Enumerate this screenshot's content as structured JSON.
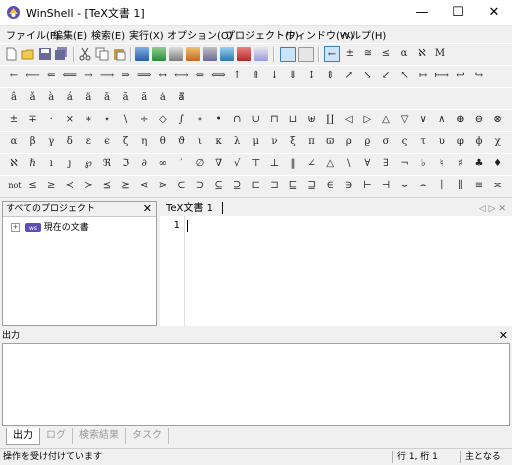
{
  "window": {
    "title": "WinShell - [TeX文書 1]",
    "minimize": "—",
    "maximize": "☐",
    "close": "✕"
  },
  "menu": [
    "ファイル(F)",
    "編集(E)",
    "検索(E)",
    "実行(X)",
    "オプション(O)",
    "プロジェクト(P)",
    "ウィンドウ(W)",
    "ヘルプ(H)"
  ],
  "toolbar1": {
    "math_buttons": [
      "←",
      "±",
      "≅",
      "≤",
      "α",
      "ℵ",
      "M"
    ]
  },
  "symbol_rows": [
    [
      "←",
      "⟵",
      "⇐",
      "⟸",
      "→",
      "⟶",
      "⇒",
      "⟹",
      "↔",
      "⟷",
      "⇔",
      "⟺",
      "↑",
      "⇑",
      "↓",
      "⇓",
      "↕",
      "⇕",
      "↗",
      "↘",
      "↙",
      "↖",
      "↦",
      "⟼",
      "↩",
      "↪"
    ],
    [
      "â",
      "ǎ",
      "à",
      "á",
      "ä",
      "ā",
      "ã",
      "ă",
      "ȧ",
      "ā⃗"
    ],
    [
      "±",
      "∓",
      "·",
      "×",
      "∗",
      "⋆",
      "\\",
      "÷",
      "◇",
      "∫",
      "∘",
      "•",
      "∩",
      "∪",
      "⊓",
      "⊔",
      "⊎",
      "∐",
      "◁",
      "▷",
      "△",
      "▽",
      "∨",
      "∧",
      "⊕",
      "⊖",
      "⊗"
    ],
    [
      "α",
      "β",
      "γ",
      "δ",
      "ε",
      "ϵ",
      "ζ",
      "η",
      "θ",
      "ϑ",
      "ι",
      "κ",
      "λ",
      "μ",
      "ν",
      "ξ",
      "π",
      "ϖ",
      "ρ",
      "ϱ",
      "σ",
      "ς",
      "τ",
      "υ",
      "φ",
      "ϕ",
      "χ"
    ],
    [
      "ℵ",
      "ℏ",
      "ı",
      "ȷ",
      "℘",
      "ℜ",
      "ℑ",
      "∂",
      "∞",
      "′",
      "∅",
      "∇",
      "√",
      "⊤",
      "⊥",
      "‖",
      "∠",
      "△",
      "\\",
      "∀",
      "∃",
      "¬",
      "♭",
      "♮",
      "♯",
      "♣",
      "♦"
    ],
    [
      "not",
      "≤",
      "≥",
      "≺",
      "≻",
      "⪯",
      "⪰",
      "⋖",
      "⋗",
      "⊂",
      "⊃",
      "⊆",
      "⊇",
      "⊏",
      "⊐",
      "⊑",
      "⊒",
      "∈",
      "∋",
      "⊢",
      "⊣",
      "⌣",
      "⌢",
      "∣",
      "∥",
      "≡",
      "≍"
    ]
  ],
  "project_panel": {
    "title": "すべてのプロジェクト",
    "close": "✕",
    "tree_item": "現在の文書"
  },
  "editor": {
    "tab_label": "TeX文書 1",
    "line_number": "1",
    "nav": "◁ ▷ ✕"
  },
  "output_panel": {
    "title": "出力",
    "close": "✕",
    "tabs": [
      "出力",
      "ログ",
      "検索結果",
      "タスク"
    ]
  },
  "status": {
    "message": "操作を受け付けています",
    "position": "行 1, 桁 1",
    "mode": "主となる"
  }
}
